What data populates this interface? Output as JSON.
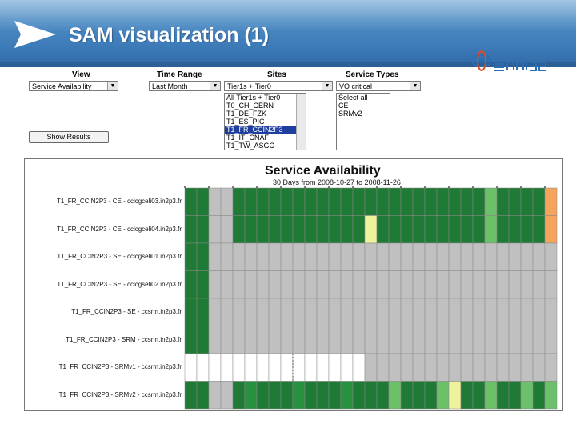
{
  "header": {
    "title": "SAM visualization (1)"
  },
  "form": {
    "view": {
      "label": "View",
      "value": "Service Availability"
    },
    "time_range": {
      "label": "Time Range",
      "value": "Last Month"
    },
    "sites": {
      "label": "Sites",
      "value": "Tier1s + Tier0",
      "options": [
        "All Tier1s + Tier0",
        "T0_CH_CERN",
        "T1_DE_FZK",
        "T1_ES_PIC",
        "T1_FR_CCIN2P3",
        "T1_IT_CNAF",
        "T1_TW_ASGC"
      ],
      "selected": "T1_FR_CCIN2P3"
    },
    "service_types": {
      "label": "Service Types",
      "value": "VO critical",
      "options": [
        "Select all",
        "CE",
        "SRMv2"
      ]
    },
    "show_results": "Show Results"
  },
  "chart_data": {
    "type": "heatmap",
    "title": "Service Availability",
    "subtitle": "30 Days from 2008-10-27 to 2008-11-26",
    "rows": [
      "T1_FR_CCIN2P3 - CE - cclcgceli03.in2p3.fr",
      "T1_FR_CCIN2P3 - CE - cclcgceli04.in2p3.fr",
      "T1_FR_CCIN2P3 - SE - cclcgseli01.in2p3.fr",
      "T1_FR_CCIN2P3 - SE - cclcgseli02.in2p3.fr",
      "T1_FR_CCIN2P3 - SE - ccsrm.in2p3.fr",
      "T1_FR_CCIN2P3 - SRM - ccsrm.in2p3.fr",
      "T1_FR_CCIN2P3 - SRMv1 - ccsrm.in2p3.fr",
      "T1_FR_CCIN2P3 - SRMv2 - ccsrm.in2p3.fr"
    ],
    "legend_colors": {
      "G": "#1e7a34",
      "g": "#27913f",
      "L": "#6cc06a",
      "Y": "#eef29a",
      "O": "#f5a45e",
      "N": "#c0c0c0",
      "W": "#ffffff"
    },
    "grid": [
      "GGNNGGGGGGGGGGGGGGGGGGGGGLGGGGO",
      "GGNNGGGGGGGGGGGYGGGGGGGGGLGGGGO",
      "GGNNNNNNNNNNNNNNNNNNNNNNNNNNNNN",
      "GGNNNNNNNNNNNNNNNNNNNNNNNNNNNNN",
      "GGNNNNNNNNNNNNNNNNNNNNNNNNNNNNN",
      "GGNNNNNNNNNNNNNNNNNNNNNNNNNNNNN",
      "WWWWWWWWWWWWWWWNNNNNNNNNNNNNNNN",
      "GGNNGgGGGgGGGgGGGLGGGLYGGLGGLGL"
    ]
  }
}
